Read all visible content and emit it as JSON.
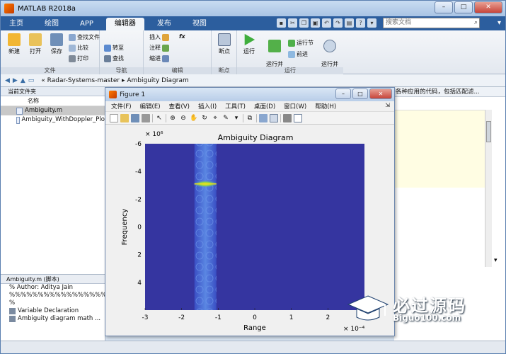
{
  "window": {
    "title": "MATLAB R2018a",
    "min": "–",
    "max": "□",
    "close": "✕"
  },
  "tabs": [
    "主页",
    "绘图",
    "APP",
    "编辑器",
    "发布",
    "视图"
  ],
  "active_tab": 3,
  "search": {
    "placeholder": "搜索文档"
  },
  "ribbon": {
    "file_group": {
      "label": "文件",
      "new": "新建",
      "open": "打开",
      "save": "保存",
      "find_files": "查找文件",
      "compare": "比较",
      "print": "打印"
    },
    "nav_group": {
      "label": "导航",
      "goto": "转至",
      "find": "查找"
    },
    "edit_group": {
      "label": "编辑",
      "insert": "插入",
      "comment": "注释",
      "indent": "缩进",
      "fx": "fx"
    },
    "break_group": {
      "label": "断点",
      "breakpoints": "断点"
    },
    "run_group": {
      "label": "运行",
      "run": "运行",
      "run_advance": "运行并\n前进",
      "run_section": "运行节",
      "advance": "前进",
      "run_time": "运行并\n计时"
    }
  },
  "address": {
    "path_parts": [
      "«",
      "Radar-Systems-master",
      "▸",
      "Ambiguity Diagram"
    ]
  },
  "current_folder": {
    "header": "当前文件夹",
    "col_name": "名称",
    "files": [
      {
        "name": "Ambiguity.m",
        "selected": true
      },
      {
        "name": "Ambiguity_WithDoppler_Plo",
        "selected": false
      }
    ]
  },
  "details": {
    "header": "Ambiguity.m  (脚本)",
    "lines": [
      "% Author: Aditya Jain",
      "%%%%%%%%%%%%%%%%%%%%",
      "%"
    ],
    "items": [
      "Variable Declaration",
      "Ambiguity diagram math ..."
    ]
  },
  "right_pane": {
    "hint": "各种应用的代码，包括匹配滤..."
  },
  "figure": {
    "title": "Figure 1",
    "menu": [
      "文件(F)",
      "编辑(E)",
      "查看(V)",
      "插入(I)",
      "工具(T)",
      "桌面(D)",
      "窗口(W)",
      "帮助(H)"
    ]
  },
  "chart_data": {
    "type": "heatmap",
    "title": "Ambiguity Diagram",
    "xlabel": "Range",
    "ylabel": "Frequency",
    "x_ticks": [
      -3,
      -2,
      -1,
      0,
      1,
      2
    ],
    "x_tick_labels": [
      "-3",
      "-2",
      "-1",
      "0",
      "1",
      "2"
    ],
    "x_multiplier": "× 10⁻⁴",
    "x_range": [
      -3,
      3
    ],
    "y_ticks": [
      -6,
      -4,
      -2,
      0,
      2,
      4
    ],
    "y_tick_labels": [
      "-6",
      "-4",
      "-2",
      "0",
      "2",
      "4"
    ],
    "y_multiplier": "× 10⁶",
    "y_range": [
      -6,
      6
    ],
    "y_reversed": true,
    "background_color": "#3535a0",
    "band": {
      "x_range": [
        -1.65,
        -1.05
      ],
      "peak_y": -3.1,
      "color": "#4b6fd6",
      "peak_color": "#e8e01a"
    }
  },
  "watermark": {
    "title": "必过源码",
    "url": "Biguo100.com"
  }
}
